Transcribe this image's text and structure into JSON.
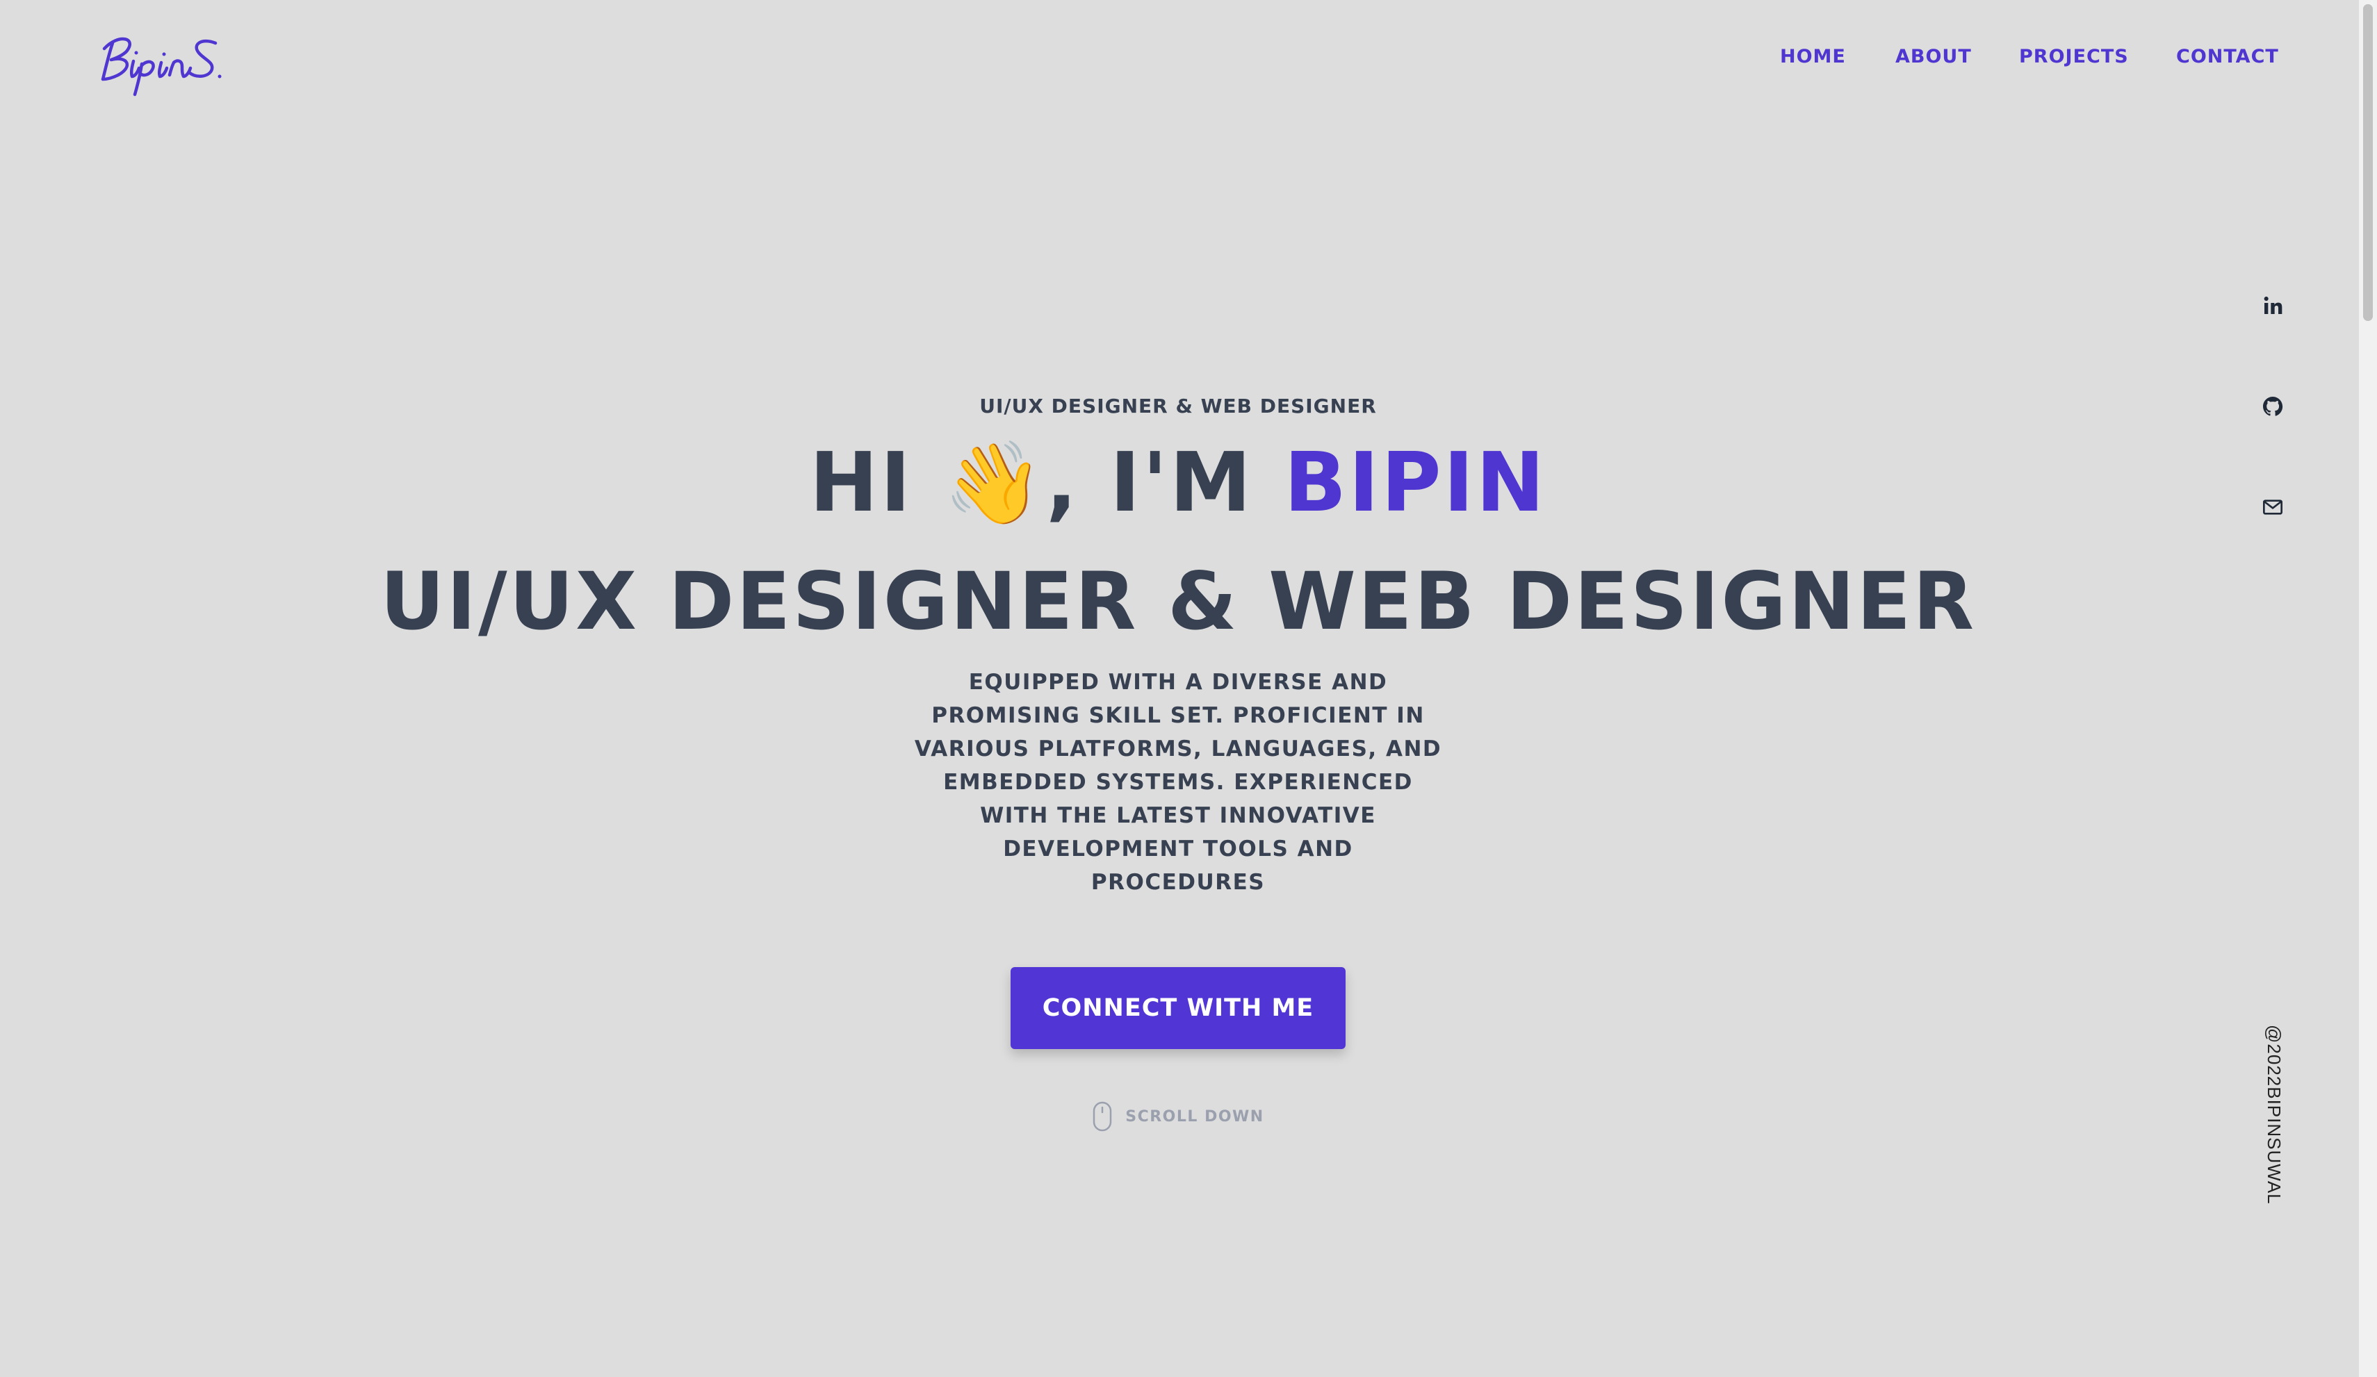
{
  "brand": {
    "logo_text": "BipinS"
  },
  "nav": {
    "items": [
      {
        "label": "HOME"
      },
      {
        "label": "ABOUT"
      },
      {
        "label": "PROJECTS"
      },
      {
        "label": "CONTACT"
      }
    ]
  },
  "social": {
    "icons": [
      "linkedin-icon",
      "github-icon",
      "mail-icon"
    ],
    "copyright": "@2022BIPINSUWAL"
  },
  "hero": {
    "eyebrow": "UI/UX DESIGNER & WEB DESIGNER",
    "greeting_prefix": "HI ",
    "wave_emoji": "👋",
    "greeting_mid": ", I'M ",
    "name": "BIPIN",
    "subheadline": "UI/UX DESIGNER & WEB DESIGNER",
    "description": "EQUIPPED WITH A DIVERSE AND PROMISING SKILL SET. PROFICIENT IN VARIOUS PLATFORMS, LANGUAGES, AND EMBEDDED SYSTEMS. EXPERIENCED WITH THE LATEST INNOVATIVE DEVELOPMENT TOOLS AND PROCEDURES",
    "cta_label": "CONNECT WITH ME",
    "scroll_label": "SCROLL DOWN"
  },
  "colors": {
    "background": "#dddddd",
    "accent": "#4f36d1",
    "text": "#374151",
    "muted": "#9aa0ad"
  }
}
